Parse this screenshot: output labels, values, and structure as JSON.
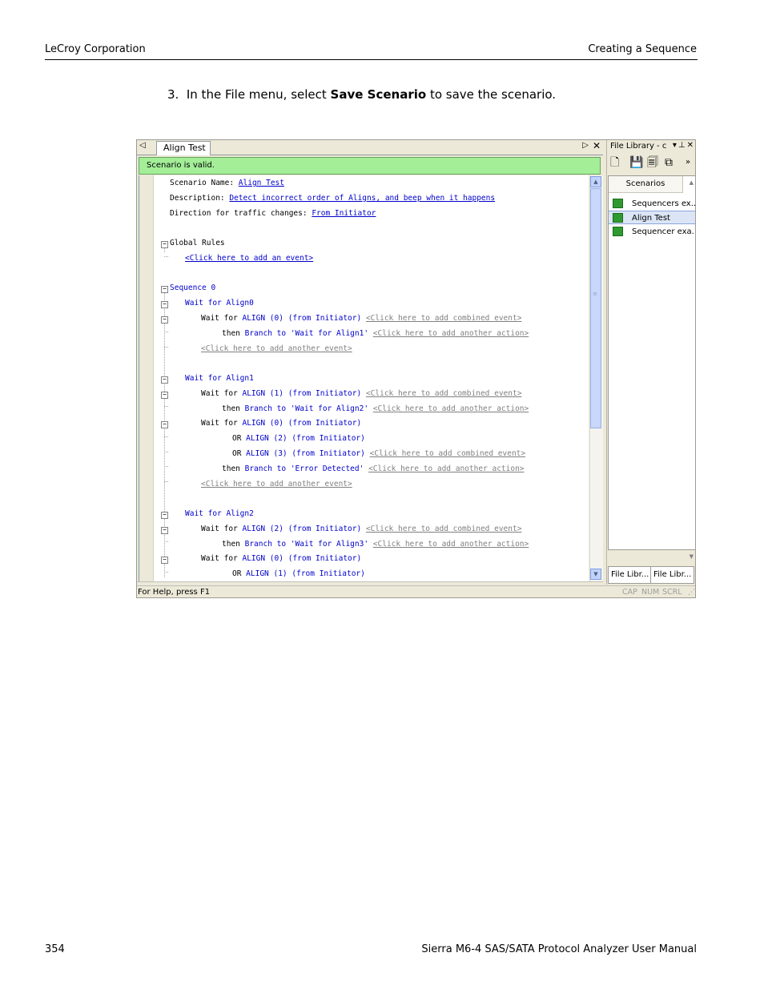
{
  "header": {
    "left": "LeCroy Corporation",
    "right": "Creating a Sequence"
  },
  "footer": {
    "page_number": "354",
    "title": "Sierra M6-4 SAS/SATA Protocol Analyzer User Manual"
  },
  "instruction": {
    "number": "3.",
    "prefix": "In the File menu, select ",
    "bold": "Save Scenario",
    "suffix": " to save the scenario."
  },
  "screenshot": {
    "tab_label": "Align Test",
    "validation_message": "Scenario is valid.",
    "editor": {
      "scenario_name_label": "Scenario Name: ",
      "scenario_name_value": "Align Test",
      "description_label": "Description: ",
      "description_value": "Detect incorrect order of Aligns, and beep when it happens",
      "direction_label": "Direction for traffic changes: ",
      "direction_value": "From Initiator",
      "global_rules": "Global Rules",
      "add_event": "<Click here to add an event>",
      "sequence": "Sequence 0",
      "wait_for": "Wait for ",
      "then": "then ",
      "or": "OR ",
      "branch_to": "Branch to ",
      "from_initiator": "(from Initiator)",
      "add_combined": "<Click here to add combined event>",
      "add_another_action": "<Click here to add another action>",
      "add_another_event": "<Click here to add another event>",
      "state_align0": "Wait for Align0",
      "state_align1": "Wait for Align1",
      "state_align2": "Wait for Align2",
      "align0": "ALIGN (0)",
      "align1": "ALIGN (1)",
      "align2": "ALIGN (2)",
      "align3": "ALIGN (3)",
      "target_align1": "'Wait for Align1'",
      "target_align2": "'Wait for Align2'",
      "target_align3": "'Wait for Align3'",
      "target_error": "'Error Detected'"
    },
    "status_bar": {
      "help": "For Help, press F1",
      "cap": "CAP",
      "num": "NUM",
      "scrl": "SCRL"
    },
    "file_library": {
      "title": "File Library - c",
      "column_header": "Scenarios",
      "items": [
        "Sequencers ex...",
        "Align Test",
        "Sequencer exa..."
      ],
      "selected_index": 1,
      "bottom_tabs": [
        "File Libr...",
        "File Libr..."
      ]
    }
  }
}
